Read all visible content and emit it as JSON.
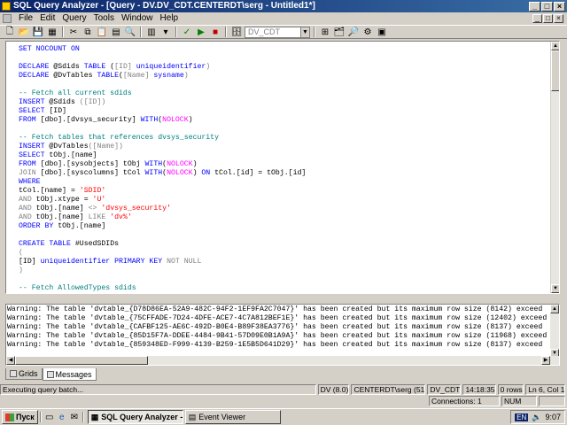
{
  "window": {
    "title": "SQL Query Analyzer - [Query - DV.DV_CDT.CENTERDT\\serg - Untitled1*]",
    "minimize": "_",
    "maximize": "□",
    "close": "×"
  },
  "menu": [
    "File",
    "Edit",
    "Query",
    "Tools",
    "Window",
    "Help"
  ],
  "toolbar": {
    "database": "DV_CDT"
  },
  "editor": {
    "lines": [
      [
        {
          "t": "SET NOCOUNT ON",
          "c": "kw"
        }
      ],
      [],
      [
        {
          "t": "DECLARE",
          "c": "kw"
        },
        {
          "t": " @Sdids "
        },
        {
          "t": "TABLE",
          "c": "kw"
        },
        {
          "t": " ("
        },
        {
          "t": "[ID]",
          "c": "gr"
        },
        {
          "t": " uniqueidentifier",
          "c": "kw"
        },
        {
          "t": ")",
          "c": "gr"
        }
      ],
      [
        {
          "t": "DECLARE",
          "c": "kw"
        },
        {
          "t": " @DvTables "
        },
        {
          "t": "TABLE",
          "c": "kw"
        },
        {
          "t": "("
        },
        {
          "t": "[Name]",
          "c": "gr"
        },
        {
          "t": " sysname",
          "c": "kw"
        },
        {
          "t": ")",
          "c": "gr"
        }
      ],
      [],
      [
        {
          "t": "-- Fetch all current sdids",
          "c": "cm"
        }
      ],
      [
        {
          "t": "INSERT",
          "c": "kw"
        },
        {
          "t": " @Sdids "
        },
        {
          "t": "([ID])",
          "c": "gr"
        }
      ],
      [
        {
          "t": "SELECT",
          "c": "kw"
        },
        {
          "t": " [ID]"
        }
      ],
      [
        {
          "t": "FROM",
          "c": "kw"
        },
        {
          "t": " [dbo].[dvsys_security] "
        },
        {
          "t": "WITH",
          "c": "kw"
        },
        {
          "t": "("
        },
        {
          "t": "NOLOCK",
          "c": "fn"
        },
        {
          "t": ")"
        }
      ],
      [],
      [
        {
          "t": "-- Fetch tables that references dvsys_security",
          "c": "cm"
        }
      ],
      [
        {
          "t": "INSERT",
          "c": "kw"
        },
        {
          "t": " @DvTables"
        },
        {
          "t": "([Name])",
          "c": "gr"
        }
      ],
      [
        {
          "t": "SELECT",
          "c": "kw"
        },
        {
          "t": " tObj.[name]"
        }
      ],
      [
        {
          "t": "FROM",
          "c": "kw"
        },
        {
          "t": " [dbo].[sysobjects] tObj "
        },
        {
          "t": "WITH",
          "c": "kw"
        },
        {
          "t": "("
        },
        {
          "t": "NOLOCK",
          "c": "fn"
        },
        {
          "t": ")"
        }
      ],
      [
        {
          "t": "JOIN",
          "c": "gr"
        },
        {
          "t": " [dbo].[syscolumns] tCol "
        },
        {
          "t": "WITH",
          "c": "kw"
        },
        {
          "t": "("
        },
        {
          "t": "NOLOCK",
          "c": "fn"
        },
        {
          "t": ") "
        },
        {
          "t": "ON",
          "c": "kw"
        },
        {
          "t": " tCol.[id] = tObj.[id]"
        }
      ],
      [
        {
          "t": "WHERE",
          "c": "kw"
        }
      ],
      [
        {
          "t": "tCol.[name] = "
        },
        {
          "t": "'SDID'",
          "c": "st"
        }
      ],
      [
        {
          "t": "AND",
          "c": "gr"
        },
        {
          "t": " tObj.xtype = "
        },
        {
          "t": "'U'",
          "c": "st"
        }
      ],
      [
        {
          "t": "AND",
          "c": "gr"
        },
        {
          "t": " tObj.[name] "
        },
        {
          "t": "<>",
          "c": "gr"
        },
        {
          "t": " 'dvsys_security'",
          "c": "st"
        }
      ],
      [
        {
          "t": "AND",
          "c": "gr"
        },
        {
          "t": " tObj.[name] "
        },
        {
          "t": "LIKE",
          "c": "gr"
        },
        {
          "t": " 'dv%'",
          "c": "st"
        }
      ],
      [
        {
          "t": "ORDER BY",
          "c": "kw"
        },
        {
          "t": " tObj.[name]"
        }
      ],
      [],
      [
        {
          "t": "CREATE TABLE",
          "c": "kw"
        },
        {
          "t": " #UsedSDIDs"
        }
      ],
      [
        {
          "t": "(",
          "c": "gr"
        }
      ],
      [
        {
          "t": "[ID] "
        },
        {
          "t": "uniqueidentifier PRIMARY KEY",
          "c": "kw"
        },
        {
          "t": " NOT NULL",
          "c": "gr"
        }
      ],
      [
        {
          "t": ")",
          "c": "gr"
        }
      ],
      [],
      [
        {
          "t": "-- Fetch AllowedTypes sdids",
          "c": "cm"
        }
      ]
    ]
  },
  "messages": [
    "Warning: The table 'dvtable_{D78D86EA-52A9-482C-94F2-1EF9FA2C7047}' has been created but its maximum row size (8142) exceed",
    "Warning: The table 'dvtable_{75CFFADE-7D24-4DFE-ACE7-4C7A812BEF1E}' has been created but its maximum row size (12402) exceed",
    "Warning: The table 'dvtable_{CAFBF125-AE6C-492D-B0E4-B89F38EA3776}' has been created but its maximum row size (8137) exceed",
    "Warning: The table 'dvtable_{85D15F7A-DDEE-4484-9B41-57D09E0B1A9A}' has been created but its maximum row size (11968) exceed",
    "Warning: The table 'dvtable_{859348ED-F999-4139-B259-1E5B5D641D29}' has been created but its maximum row size (8137) exceed"
  ],
  "tabs": {
    "grids": "Grids",
    "messages": "Messages"
  },
  "status": {
    "text": "Executing query batch...",
    "server": "DV (8.0)",
    "user": "CENTERDT\\serg (51)",
    "db": "DV_CDT",
    "time": "14:18:35",
    "rows": "0 rows",
    "position": "Ln 6, Col 1",
    "connections": "Connections: 1",
    "num": "NUM"
  },
  "taskbar": {
    "start": "Пуск",
    "items": [
      "SQL Query Analyzer - ...",
      "Event Viewer"
    ],
    "lang": "EN",
    "clock": "9:07"
  }
}
